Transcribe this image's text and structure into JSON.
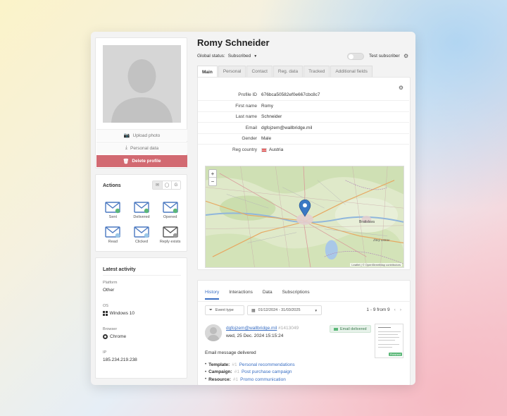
{
  "profile": {
    "name": "Romy Schneider",
    "global_status_label": "Global status:",
    "global_status_value": "Subscribed",
    "test_subscriber_label": "Test subscriber"
  },
  "sidebar": {
    "upload_photo": "Upload photo",
    "personal_data": "Personal data",
    "delete_profile": "Delete profile"
  },
  "actions": {
    "title": "Actions",
    "items": [
      {
        "label": "Sent",
        "icon": "mail-sent-icon"
      },
      {
        "label": "Delivered",
        "icon": "mail-delivered-icon"
      },
      {
        "label": "Opened",
        "icon": "mail-opened-icon"
      },
      {
        "label": "Read",
        "icon": "mail-read-icon"
      },
      {
        "label": "Clicked",
        "icon": "mail-clicked-icon"
      },
      {
        "label": "Reply exists",
        "icon": "mail-reply-icon"
      }
    ]
  },
  "activity": {
    "title": "Latest activity",
    "platform_label": "Platform",
    "platform_value": "Other",
    "os_label": "OS",
    "os_value": "Windows 10",
    "browser_label": "Browser",
    "browser_value": "Chrome",
    "ip_label": "IP",
    "ip_value": "185.234.219.238"
  },
  "tabs": [
    "Main",
    "Personal",
    "Contact",
    "Reg. data",
    "Tracked",
    "Additional fields"
  ],
  "fields": [
    {
      "label": "Profile ID",
      "value": "676bca50582ef0e667cbc8c7"
    },
    {
      "label": "First name",
      "value": "Romy"
    },
    {
      "label": "Last name",
      "value": "Schneider"
    },
    {
      "label": "Email",
      "value": "dgfojzem@wallbridge.mil"
    },
    {
      "label": "Gender",
      "value": "Male"
    },
    {
      "label": "Reg country",
      "value": "Austria"
    }
  ],
  "map": {
    "zoom_in": "+",
    "zoom_out": "−",
    "city_label": "Bratislava",
    "town_label": "Žitný ostrov",
    "attribution": "Leaflet | © OpenStreetMap contributors"
  },
  "history": {
    "tabs": [
      "History",
      "Interactions",
      "Data",
      "Subscriptions"
    ],
    "event_type_placeholder": "Event type",
    "date_range": "01/12/2024 - 31/03/2025",
    "pagination": "1 - 9 from 9",
    "event": {
      "sender": "dgfojzem@wallbridge.mil",
      "sender_id": "#1413049",
      "date": "wed, 25 Dec. 2024 15:15:24",
      "badge": "Email delivered",
      "thumb_badge": "Finished",
      "message": "Email message delivered",
      "template_label": "Template:",
      "template_id": "#1",
      "template_value": "Personal recommendations",
      "campaign_label": "Campaign:",
      "campaign_id": "#1",
      "campaign_value": "Post purchase campaign",
      "resource_label": "Resource:",
      "resource_id": "#1",
      "resource_value": "Promo communication"
    }
  },
  "colors": {
    "accent": "#3a6fc4",
    "delete": "#d26a72",
    "success": "#5cb879"
  }
}
